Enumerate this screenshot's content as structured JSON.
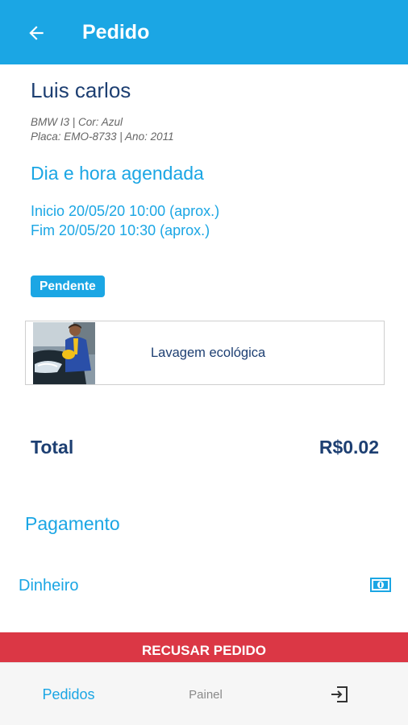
{
  "header": {
    "title": "Pedido",
    "back_icon": "arrow-left-icon"
  },
  "order": {
    "customer_name": "Luis carlos",
    "vehicle_line1": "BMW I3 | Cor: Azul",
    "vehicle_line2": "Placa: EMO-8733 | Ano: 2011",
    "schedule_title": "Dia e hora agendada",
    "start": "Inicio 20/05/20 10:00 (aprox.)",
    "end": "Fim 20/05/20 10:30 (aprox.)",
    "status": "Pendente"
  },
  "service": {
    "name": "Lavagem ecológica"
  },
  "total": {
    "label": "Total",
    "value": "R$0.02"
  },
  "payment": {
    "title": "Pagamento",
    "method": "Dinheiro",
    "icon": "cash-icon"
  },
  "actions": {
    "reject_label": "RECUSAR PEDIDO"
  },
  "bottom_nav": {
    "items": [
      {
        "label": "Pedidos",
        "active": true
      },
      {
        "label": "Painel",
        "active": false
      },
      {
        "label": "",
        "icon": "exit-icon"
      }
    ]
  },
  "colors": {
    "primary": "#1ba6e4",
    "dark_text": "#1d3f72",
    "danger": "#db3745"
  }
}
